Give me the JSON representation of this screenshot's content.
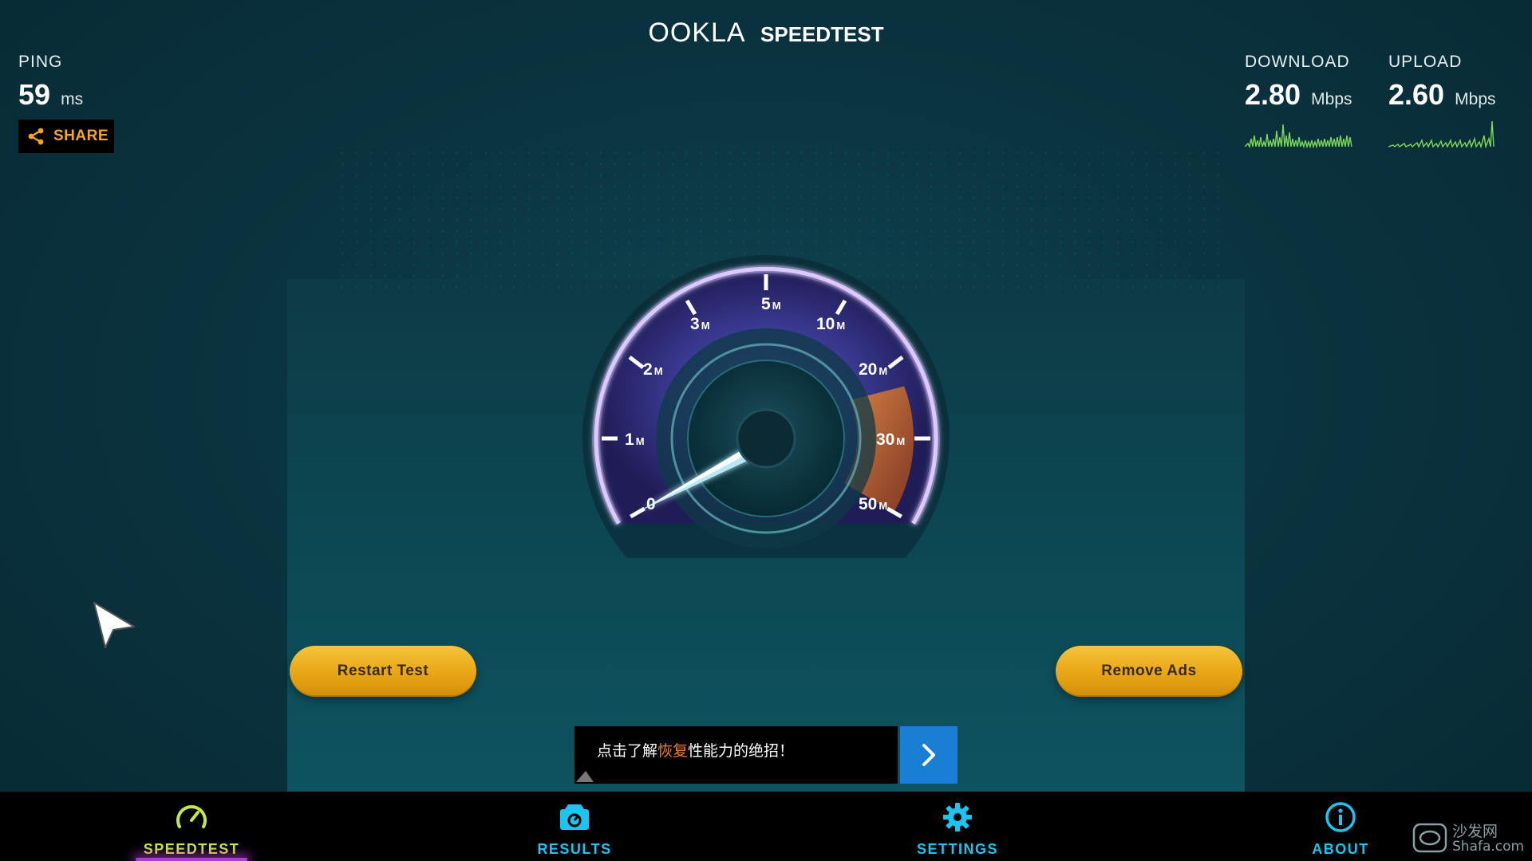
{
  "brand": {
    "logo": "OOKLA",
    "product": "SPEEDTEST"
  },
  "ping": {
    "label": "PING",
    "value": "59",
    "unit": "ms"
  },
  "share": {
    "label": "SHARE",
    "icon": "share-icon"
  },
  "download": {
    "label": "DOWNLOAD",
    "value": "2.80",
    "unit": "Mbps",
    "color": "#7ed957"
  },
  "upload": {
    "label": "UPLOAD",
    "value": "2.60",
    "unit": "Mbps",
    "color": "#7ed957"
  },
  "gauge": {
    "ticks": [
      {
        "num": "0",
        "unit": ""
      },
      {
        "num": "1",
        "unit": "M"
      },
      {
        "num": "2",
        "unit": "M"
      },
      {
        "num": "3",
        "unit": "M"
      },
      {
        "num": "5",
        "unit": "M"
      },
      {
        "num": "10",
        "unit": "M"
      },
      {
        "num": "20",
        "unit": "M"
      },
      {
        "num": "30",
        "unit": "M"
      },
      {
        "num": "50",
        "unit": "M"
      }
    ],
    "needle_scale_position": 0.05,
    "colors": {
      "arc": "#7a5fd6",
      "high_zone": "#d9772e",
      "needle": "#bff3ff"
    }
  },
  "buttons": {
    "restart": "Restart Test",
    "remove_ads": "Remove Ads"
  },
  "ad": {
    "text_before": "点击了解",
    "text_highlight": "恢复",
    "text_after": "性能力的绝招！",
    "arrow_icon": "chevron-right-icon"
  },
  "nav": {
    "items": [
      {
        "label": "SPEEDTEST",
        "icon": "speedometer-icon",
        "active": true
      },
      {
        "label": "RESULTS",
        "icon": "results-icon",
        "active": false
      },
      {
        "label": "SETTINGS",
        "icon": "gear-icon",
        "active": false
      },
      {
        "label": "ABOUT",
        "icon": "info-icon",
        "active": false
      }
    ]
  },
  "watermark": {
    "cn": "沙发网",
    "site": "Shafa.com"
  }
}
